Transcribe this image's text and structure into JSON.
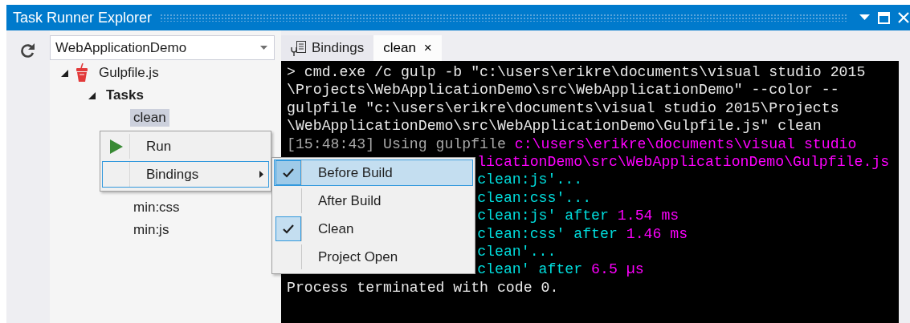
{
  "window": {
    "title": "Task Runner Explorer"
  },
  "project_dropdown": {
    "value": "WebApplicationDemo"
  },
  "tree": [
    {
      "label": "Gulpfile.js",
      "expanded": true,
      "children": [
        {
          "label": "Tasks",
          "expanded": true,
          "children": [
            {
              "label": "clean",
              "selected": true
            },
            {
              "label": "min:css",
              "selected": false
            },
            {
              "label": "min:js",
              "selected": false
            }
          ]
        }
      ]
    }
  ],
  "tabs": [
    {
      "label": "Bindings",
      "selected": false
    },
    {
      "label": "clean",
      "selected": true,
      "close": "×"
    }
  ],
  "console": {
    "blocks": [
      {
        "kind": "full",
        "lines": [
          {
            "segments": [
              {
                "text": "> cmd.exe /c gulp -b \"c:\\users\\erikre\\documents\\visual studio 2015",
                "color": "#e8e8e8"
              }
            ]
          },
          {
            "segments": [
              {
                "text": "\\Projects\\WebApplicationDemo\\src\\WebApplicationDemo\" --color --",
                "color": "#e8e8e8"
              }
            ]
          },
          {
            "segments": [
              {
                "text": "gulpfile \"c:\\users\\erikre\\documents\\visual studio 2015\\Projects",
                "color": "#e8e8e8"
              }
            ]
          },
          {
            "segments": [
              {
                "text": "\\WebApplicationDemo\\src\\WebApplicationDemo\\Gulpfile.js\" clean",
                "color": "#e8e8e8"
              }
            ]
          },
          {
            "segments": [
              {
                "text": "[15:48:43] Using gulpfile ",
                "color": "#a8a8a8"
              },
              {
                "text": "c:\\users\\erikre\\documents\\visual studio",
                "color": "#ff00ff"
              }
            ]
          }
        ]
      },
      {
        "kind": "beside_menu",
        "lines": [
          {
            "segments": [
              {
                "text": "licationDemo\\src\\WebApplicationDemo\\Gulpfile.js",
                "color": "#ff00ff"
              }
            ]
          },
          {
            "segments": [
              {
                "text": "clean:js'...",
                "color": "#00dede"
              }
            ]
          },
          {
            "segments": [
              {
                "text": "clean:css'...",
                "color": "#00dede"
              }
            ]
          },
          {
            "segments": [
              {
                "text": "clean:js' after ",
                "color": "#00dede"
              },
              {
                "text": "1.54 ms",
                "color": "#ff00ff"
              }
            ]
          },
          {
            "segments": [
              {
                "text": "clean:css' after ",
                "color": "#00dede"
              },
              {
                "text": "1.46 ms",
                "color": "#ff00ff"
              }
            ]
          },
          {
            "segments": [
              {
                "text": "clean'...",
                "color": "#00dede"
              }
            ]
          },
          {
            "segments": [
              {
                "text": "clean' after ",
                "color": "#00dede"
              },
              {
                "text": "6.5 µs",
                "color": "#ff00ff"
              }
            ]
          }
        ]
      },
      {
        "kind": "full",
        "lines": [
          {
            "segments": [
              {
                "text": "Process terminated with code 0.",
                "color": "#e8e8e8"
              }
            ]
          }
        ]
      }
    ]
  },
  "context_menu": {
    "items": [
      {
        "label": "Run",
        "kind": "command",
        "selected": false
      },
      {
        "label": "Bindings",
        "kind": "submenu",
        "selected": true
      }
    ]
  },
  "bindings_submenu": {
    "items": [
      {
        "label": "Before Build",
        "checked": true,
        "selected": true
      },
      {
        "label": "After Build",
        "checked": false,
        "selected": false
      },
      {
        "label": "Clean",
        "checked": true,
        "selected": false
      },
      {
        "label": "Project Open",
        "checked": false,
        "selected": false
      }
    ]
  }
}
